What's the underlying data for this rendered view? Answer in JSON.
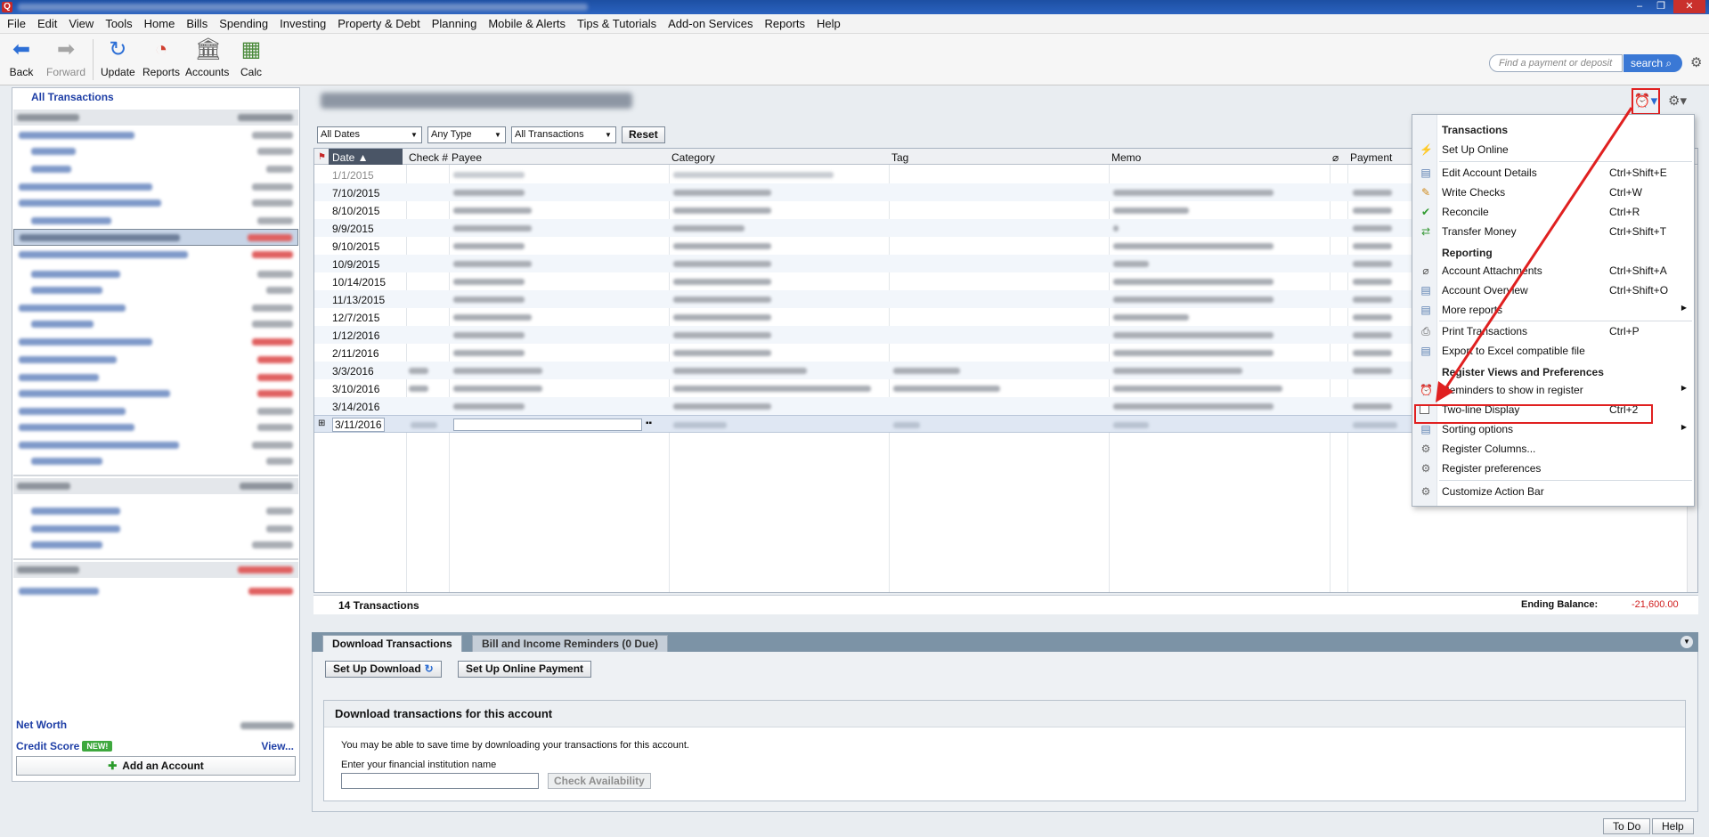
{
  "app": {
    "title_blurred": true,
    "window_buttons": [
      "–",
      "❐",
      "✕"
    ]
  },
  "menubar": [
    "File",
    "Edit",
    "View",
    "Tools",
    "Home",
    "Bills",
    "Spending",
    "Investing",
    "Property & Debt",
    "Planning",
    "Mobile & Alerts",
    "Tips & Tutorials",
    "Add-on Services",
    "Reports",
    "Help"
  ],
  "toolbar": {
    "back": "Back",
    "forward": "Forward",
    "update": "Update",
    "reports": "Reports",
    "accounts": "Accounts",
    "calc": "Calc",
    "search_placeholder": "Find a payment or deposit",
    "search_button": "search"
  },
  "sidebar": {
    "all_transactions": "All Transactions",
    "net_worth": "Net Worth",
    "credit_score": "Credit Score",
    "new_badge": "NEW!",
    "view_link": "View...",
    "add_account": "Add an Account"
  },
  "filters": {
    "dates": "All Dates",
    "type": "Any Type",
    "transactions": "All Transactions",
    "reset": "Reset"
  },
  "register": {
    "columns": {
      "date": "Date ▲",
      "check": "Check #",
      "payee": "Payee",
      "category": "Category",
      "tag": "Tag",
      "memo": "Memo",
      "payment": "Payment"
    },
    "rows": [
      {
        "date": "1/1/2015",
        "faded": true
      },
      {
        "date": "7/10/2015"
      },
      {
        "date": "8/10/2015"
      },
      {
        "date": "9/9/2015"
      },
      {
        "date": "9/10/2015"
      },
      {
        "date": "10/9/2015"
      },
      {
        "date": "10/14/2015"
      },
      {
        "date": "11/13/2015"
      },
      {
        "date": "12/7/2015"
      },
      {
        "date": "1/12/2016"
      },
      {
        "date": "2/11/2016"
      },
      {
        "date": "3/3/2016"
      },
      {
        "date": "3/10/2016"
      },
      {
        "date": "3/14/2016"
      }
    ],
    "edit_row": {
      "date": "3/11/2016"
    },
    "count": "14 Transactions",
    "ending_balance_label": "Ending Balance:",
    "ending_balance_value": "-21,600.00"
  },
  "bottom": {
    "tab_download": "Download Transactions",
    "tab_reminders": "Bill and Income Reminders (0 Due)",
    "setup_download": "Set Up Download",
    "setup_online_payment": "Set Up Online Payment",
    "panel_title": "Download transactions for this account",
    "panel_message": "You may be able to save time by downloading your transactions for this account.",
    "institution_label": "Enter your financial institution name",
    "check_availability": "Check Availability",
    "todo": "To Do",
    "help": "Help"
  },
  "action_menu": {
    "section_transactions": "Transactions",
    "set_up_online": "Set Up Online",
    "edit_account_details": "Edit Account Details",
    "edit_account_details_shortcut": "Ctrl+Shift+E",
    "write_checks": "Write Checks",
    "write_checks_shortcut": "Ctrl+W",
    "reconcile": "Reconcile",
    "reconcile_shortcut": "Ctrl+R",
    "transfer_money": "Transfer Money",
    "transfer_money_shortcut": "Ctrl+Shift+T",
    "section_reporting": "Reporting",
    "account_attachments": "Account Attachments",
    "account_attachments_shortcut": "Ctrl+Shift+A",
    "account_overview": "Account Overview",
    "account_overview_shortcut": "Ctrl+Shift+O",
    "more_reports": "More reports",
    "print_transactions": "Print Transactions",
    "print_transactions_shortcut": "Ctrl+P",
    "export_excel": "Export to Excel compatible file",
    "section_register": "Register Views and Preferences",
    "reminders_in_register": "Reminders to show in register",
    "two_line_display": "Two-line Display",
    "two_line_display_shortcut": "Ctrl+2",
    "sorting_options": "Sorting options",
    "register_columns": "Register Columns...",
    "register_preferences": "Register preferences",
    "customize_action_bar": "Customize Action Bar"
  },
  "colors": {
    "accent_blue": "#1f3fa6",
    "annotation_red": "#e02020",
    "negative": "#d01e1e"
  }
}
